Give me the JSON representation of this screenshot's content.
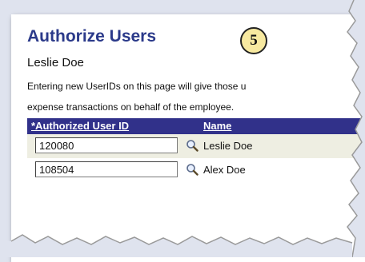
{
  "page": {
    "title": "Authorize Users",
    "step_number": "5",
    "employee_name": "Leslie Doe",
    "instructions": [
      "Entering new UserIDs on this page will give those u",
      "expense transactions on behalf of the employee."
    ]
  },
  "grid": {
    "columns": {
      "user_id": "*Authorized User ID",
      "name": "Name"
    },
    "rows": [
      {
        "user_id": "120080",
        "name": "Leslie Doe"
      },
      {
        "user_id": "108504",
        "name": "Alex Doe"
      }
    ]
  },
  "icons": {
    "lookup": "magnifier-lookup-icon"
  },
  "colors": {
    "title": "#2b3a8a",
    "grid_header": "#31318a",
    "badge": "#f7e9a0"
  }
}
